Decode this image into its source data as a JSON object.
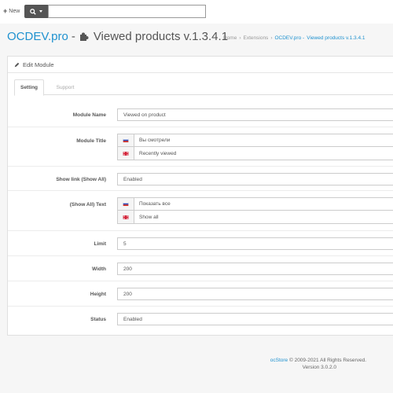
{
  "topbar": {
    "new_label": "New",
    "search_value": ""
  },
  "header": {
    "title_brand": "OCDEV.pro",
    "title_dash": "-",
    "title_rest": "Viewed products v.1.3.4.1",
    "breadcrumb": {
      "home": "Home",
      "extensions": "Extensions",
      "current": "OCDEV.pro -  Viewed products v.1.3.4.1"
    }
  },
  "panel": {
    "heading": "Edit Module",
    "tabs": [
      "Setting",
      "Support"
    ],
    "fields": {
      "module_name": {
        "label": "Module Name",
        "value": "Viewed on product"
      },
      "module_title": {
        "label": "Module Title",
        "ru": "Вы смотрели",
        "en": "Recently viewed"
      },
      "show_link": {
        "label": "Show link (Show All)",
        "value": "Enabled"
      },
      "show_all_text": {
        "label": "(Show All) Text",
        "ru": "Показать все",
        "en": "Show all"
      },
      "limit": {
        "label": "Limit",
        "value": "5"
      },
      "width": {
        "label": "Width",
        "value": "200"
      },
      "height": {
        "label": "Height",
        "value": "200"
      },
      "status": {
        "label": "Status",
        "value": "Enabled"
      }
    }
  },
  "footer": {
    "brand": "ocStore",
    "copyright": "© 2009-2021 All Rights Reserved.",
    "version": "Version 3.0.2.0"
  },
  "colors": {
    "accent": "#1e91cf",
    "search_button": "#555555"
  },
  "icons": {
    "new": "plus-icon",
    "search": "search-icon",
    "title": "puzzle-icon",
    "heading": "pencil-icon",
    "flag_ru": "flag-ru-icon",
    "flag_en": "flag-gb-icon"
  }
}
